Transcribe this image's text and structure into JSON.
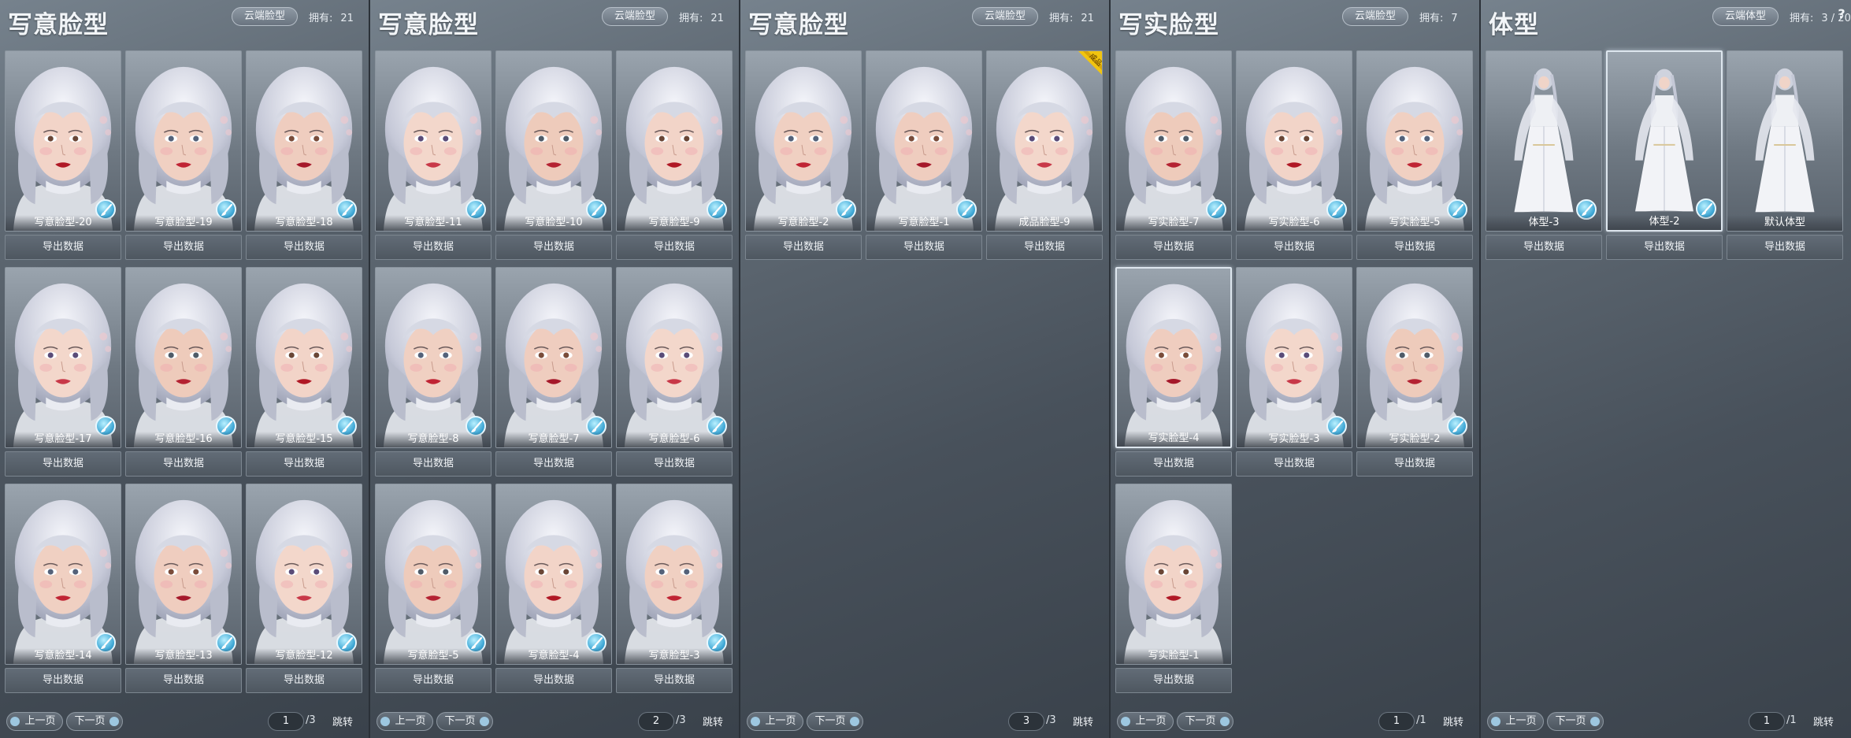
{
  "panels": [
    {
      "title": "写意脸型",
      "cloud_label": "云端脸型",
      "owned_label": "拥有:",
      "owned_count": "21",
      "help": "",
      "kind": "face",
      "items": [
        {
          "label": "写意脸型-20",
          "brush": true
        },
        {
          "label": "写意脸型-19",
          "brush": true
        },
        {
          "label": "写意脸型-18",
          "brush": true
        },
        {
          "label": "写意脸型-17",
          "brush": true
        },
        {
          "label": "写意脸型-16",
          "brush": true
        },
        {
          "label": "写意脸型-15",
          "brush": true
        },
        {
          "label": "写意脸型-14",
          "brush": true
        },
        {
          "label": "写意脸型-13",
          "brush": true
        },
        {
          "label": "写意脸型-12",
          "brush": true
        }
      ],
      "export_label": "导出数据",
      "pager": {
        "prev": "上一页",
        "next": "下一页",
        "page": "1",
        "total": "/3",
        "jump": "跳转"
      }
    },
    {
      "title": "写意脸型",
      "cloud_label": "云端脸型",
      "owned_label": "拥有:",
      "owned_count": "21",
      "help": "",
      "kind": "face",
      "items": [
        {
          "label": "写意脸型-11",
          "brush": true
        },
        {
          "label": "写意脸型-10",
          "brush": true
        },
        {
          "label": "写意脸型-9",
          "brush": true
        },
        {
          "label": "写意脸型-8",
          "brush": true
        },
        {
          "label": "写意脸型-7",
          "brush": true
        },
        {
          "label": "写意脸型-6",
          "brush": true
        },
        {
          "label": "写意脸型-5",
          "brush": true
        },
        {
          "label": "写意脸型-4",
          "brush": true
        },
        {
          "label": "写意脸型-3",
          "brush": true
        }
      ],
      "export_label": "导出数据",
      "pager": {
        "prev": "上一页",
        "next": "下一页",
        "page": "2",
        "total": "/3",
        "jump": "跳转"
      }
    },
    {
      "title": "写意脸型",
      "cloud_label": "云端脸型",
      "owned_label": "拥有:",
      "owned_count": "21",
      "help": "",
      "kind": "face",
      "items": [
        {
          "label": "写意脸型-2",
          "brush": true
        },
        {
          "label": "写意脸型-1",
          "brush": true
        },
        {
          "label": "成品脸型-9",
          "brush": false,
          "tag": "成品"
        }
      ],
      "export_label": "导出数据",
      "pager": {
        "prev": "上一页",
        "next": "下一页",
        "page": "3",
        "total": "/3",
        "jump": "跳转"
      }
    },
    {
      "title": "写实脸型",
      "cloud_label": "云端脸型",
      "owned_label": "拥有:",
      "owned_count": "7",
      "help": "",
      "kind": "face",
      "items": [
        {
          "label": "写实脸型-7",
          "brush": true
        },
        {
          "label": "写实脸型-6",
          "brush": true
        },
        {
          "label": "写实脸型-5",
          "brush": true
        },
        {
          "label": "写实脸型-4",
          "brush": false,
          "selected": true
        },
        {
          "label": "写实脸型-3",
          "brush": true
        },
        {
          "label": "写实脸型-2",
          "brush": true
        },
        {
          "label": "写实脸型-1",
          "brush": false
        }
      ],
      "export_label": "导出数据",
      "pager": {
        "prev": "上一页",
        "next": "下一页",
        "page": "1",
        "total": "/1",
        "jump": "跳转"
      }
    },
    {
      "title": "体型",
      "cloud_label": "云端体型",
      "owned_label": "拥有:",
      "owned_count": "3 / 20",
      "help": "?",
      "kind": "body",
      "items": [
        {
          "label": "体型-3",
          "brush": true
        },
        {
          "label": "体型-2",
          "brush": true,
          "selected": true
        },
        {
          "label": "默认体型",
          "brush": false
        }
      ],
      "export_label": "导出数据",
      "pager": {
        "prev": "上一页",
        "next": "下一页",
        "page": "1",
        "total": "/1",
        "jump": "跳转"
      }
    }
  ],
  "colors": {
    "accent": "#3fa8d6",
    "tag_gold": "#f1c40f",
    "panel_bg": "#4f5963"
  },
  "icons": {
    "brush": "paint-brush-icon",
    "tag": "finished-product-ribbon-icon",
    "help": "question-icon",
    "arrow": "arrow-icon"
  }
}
